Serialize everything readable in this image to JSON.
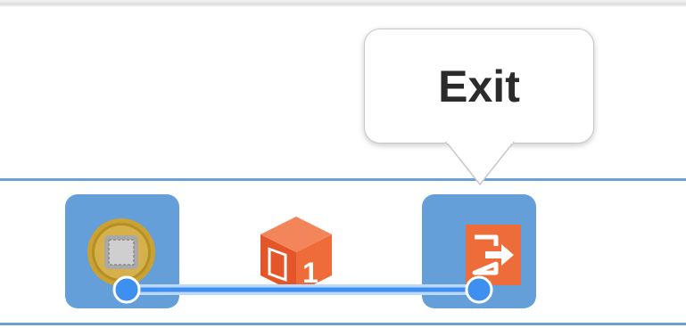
{
  "tooltip": {
    "label": "Exit"
  },
  "tiles": [
    {
      "name": "start-tile",
      "icon": "coin-token-icon"
    },
    {
      "name": "exit-tile",
      "icon": "exit-door-icon"
    }
  ],
  "cube": {
    "icon": "numbered-cube-icon",
    "number": "1"
  },
  "colors": {
    "rule": "#6a9fd8",
    "tile": "#649fd9",
    "accent_orange": "#ee6b3a",
    "path_blue": "#3d8ff0",
    "coin_gold": "#c9a233"
  }
}
